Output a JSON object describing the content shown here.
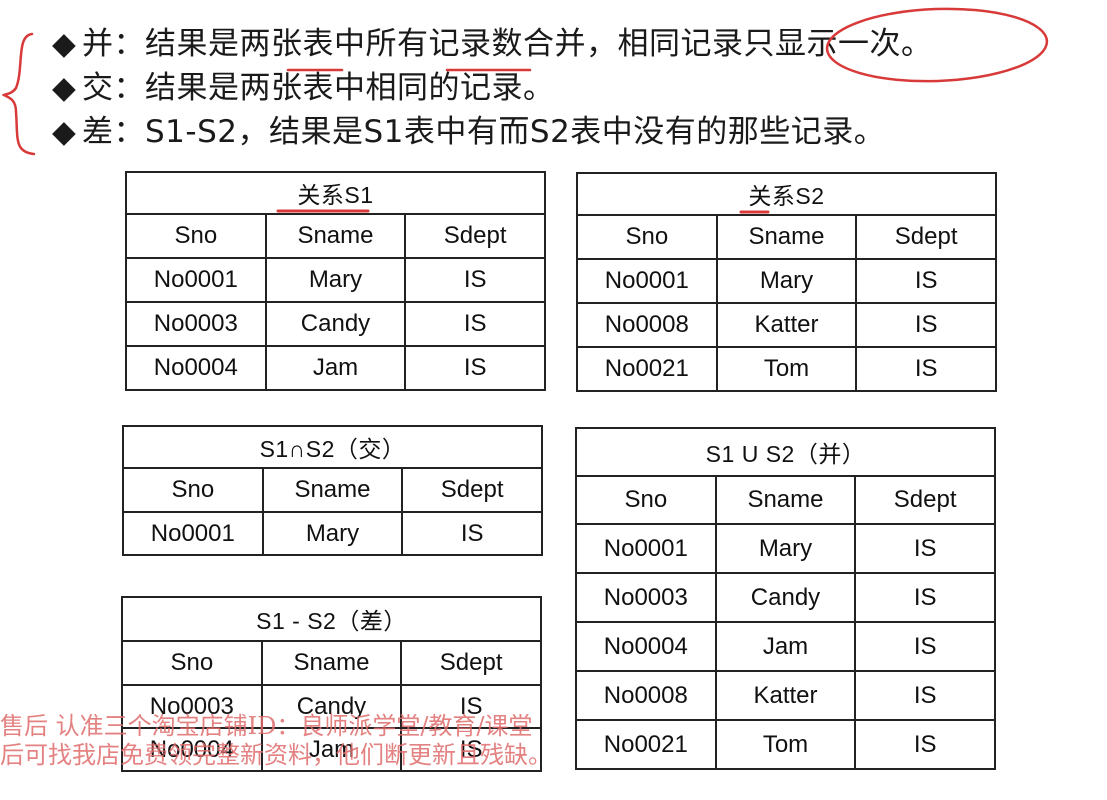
{
  "bullets": [
    {
      "symbol": "◆",
      "text": "并：结果是两张表中所有记录数合并，相同记录只显示一次。"
    },
    {
      "symbol": "◆",
      "text": "交：结果是两张表中相同的记录。"
    },
    {
      "symbol": "◆",
      "text": "差：S1-S2，结果是S1表中有而S2表中没有的那些记录。"
    }
  ],
  "columns": [
    "Sno",
    "Sname",
    "Sdept"
  ],
  "tables": {
    "s1": {
      "title": "关系S1",
      "rows": [
        [
          "No0001",
          "Mary",
          "IS"
        ],
        [
          "No0003",
          "Candy",
          "IS"
        ],
        [
          "No0004",
          "Jam",
          "IS"
        ]
      ]
    },
    "s2": {
      "title": "关系S2",
      "rows": [
        [
          "No0001",
          "Mary",
          "IS"
        ],
        [
          "No0008",
          "Katter",
          "IS"
        ],
        [
          "No0021",
          "Tom",
          "IS"
        ]
      ]
    },
    "inter": {
      "title": "S1∩S2（交）",
      "rows": [
        [
          "No0001",
          "Mary",
          "IS"
        ]
      ]
    },
    "union": {
      "title": "S1 U S2（并）",
      "rows": [
        [
          "No0001",
          "Mary",
          "IS"
        ],
        [
          "No0003",
          "Candy",
          "IS"
        ],
        [
          "No0004",
          "Jam",
          "IS"
        ],
        [
          "No0008",
          "Katter",
          "IS"
        ],
        [
          "No0021",
          "Tom",
          "IS"
        ]
      ]
    },
    "diff": {
      "title": "S1 - S2（差）",
      "rows": [
        [
          "No0003",
          "Candy",
          "IS"
        ],
        [
          "No0004",
          "Jam",
          "IS"
        ]
      ]
    }
  },
  "watermark": {
    "line1": "售后 认准三个淘宝店铺ID：良师派学堂/教育/课堂",
    "line2": "后可找我店免费领完整新资料，他们断更新且残缺。"
  },
  "colors": {
    "annotation": "#d83a3a",
    "watermark": "#e06c6c",
    "text": "#1a1a1a"
  }
}
